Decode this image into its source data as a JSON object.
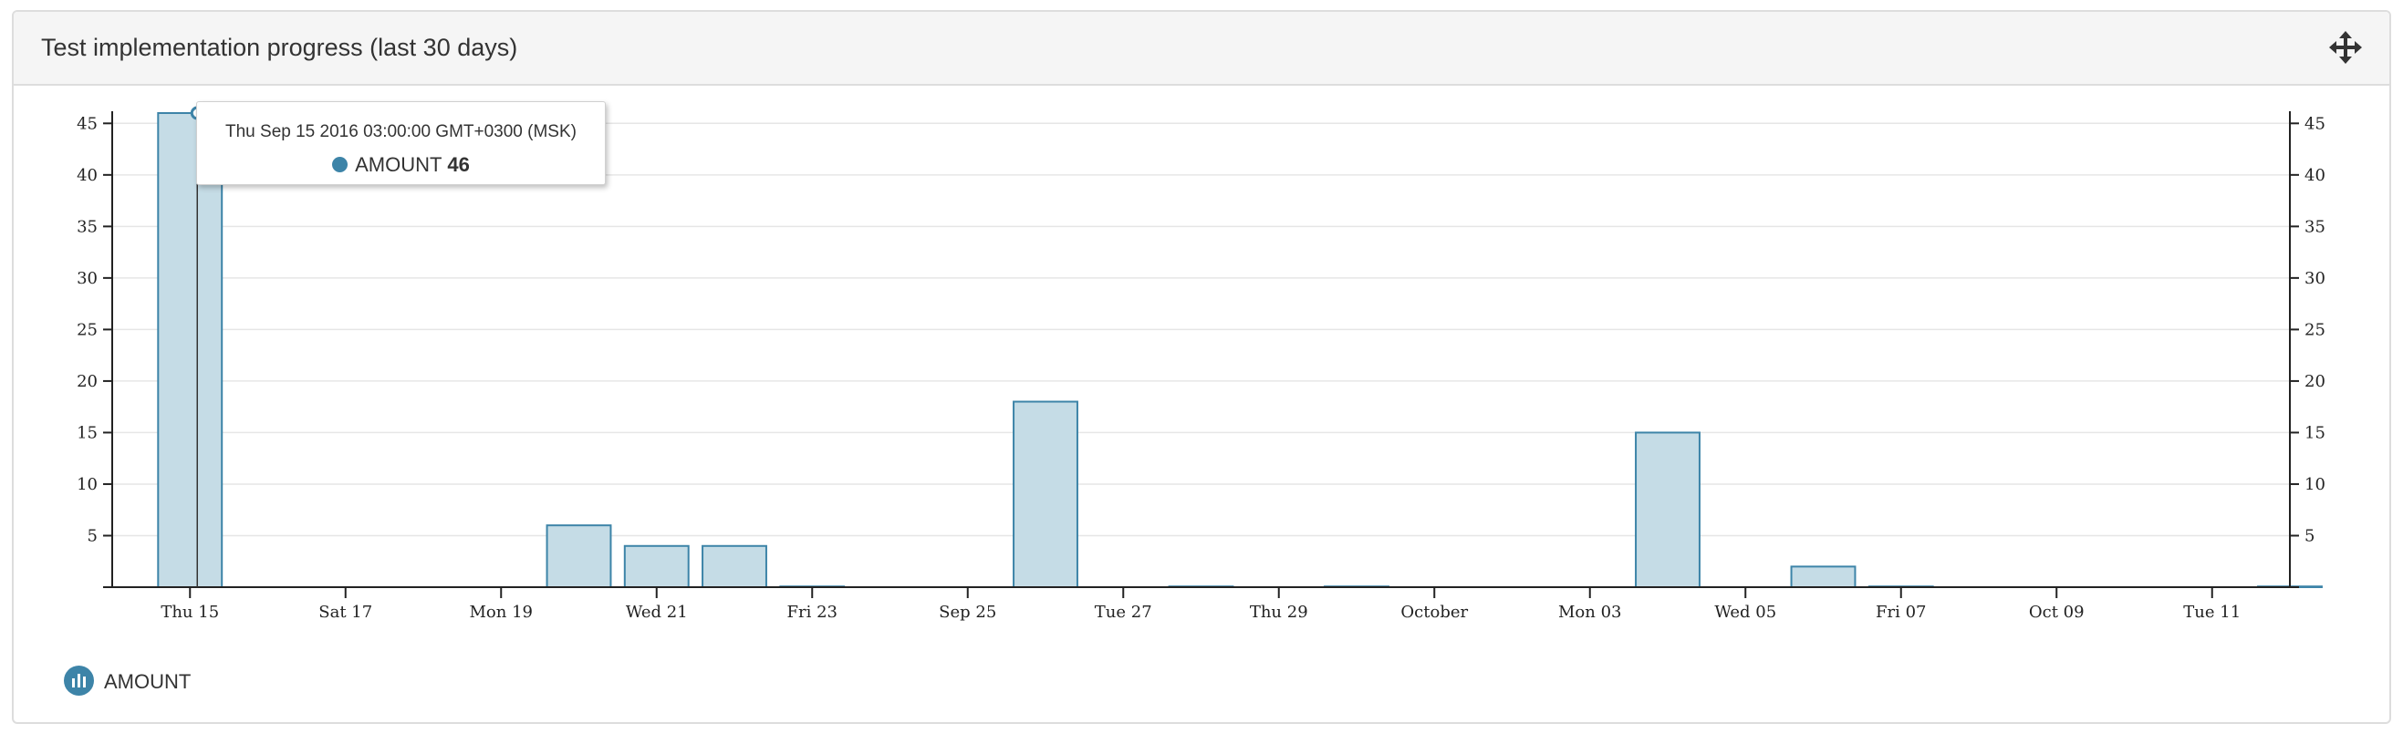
{
  "panel": {
    "title": "Test implementation progress (last 30 days)",
    "move_icon": "move-arrows-icon"
  },
  "colors": {
    "bar_fill": "#c5dce6",
    "bar_stroke": "#3d84a8",
    "axis": "#222222",
    "grid": "#e6e6e6",
    "legend_icon": "#3d84a8"
  },
  "chart_data": {
    "type": "bar",
    "title": "",
    "xlabel": "",
    "ylabel": "",
    "x_type": "date",
    "xlim": [
      "2016-09-14",
      "2016-10-12"
    ],
    "ylim": [
      0,
      46
    ],
    "y_ticks": [
      5,
      10,
      15,
      20,
      25,
      30,
      35,
      40,
      45
    ],
    "y_axis_right": true,
    "grid": true,
    "legend_position": "bottom-left",
    "x_ticks": [
      {
        "date": "2016-09-15",
        "label": "Thu 15"
      },
      {
        "date": "2016-09-17",
        "label": "Sat 17"
      },
      {
        "date": "2016-09-19",
        "label": "Mon 19"
      },
      {
        "date": "2016-09-21",
        "label": "Wed 21"
      },
      {
        "date": "2016-09-23",
        "label": "Fri 23"
      },
      {
        "date": "2016-09-25",
        "label": "Sep 25"
      },
      {
        "date": "2016-09-27",
        "label": "Tue 27"
      },
      {
        "date": "2016-09-29",
        "label": "Thu 29"
      },
      {
        "date": "2016-10-01",
        "label": "October"
      },
      {
        "date": "2016-10-03",
        "label": "Mon 03"
      },
      {
        "date": "2016-10-05",
        "label": "Wed 05"
      },
      {
        "date": "2016-10-07",
        "label": "Fri 07"
      },
      {
        "date": "2016-10-09",
        "label": "Oct 09"
      },
      {
        "date": "2016-10-11",
        "label": "Tue 11"
      }
    ],
    "series": [
      {
        "name": "AMOUNT",
        "points": [
          {
            "date": "2016-09-15",
            "value": 46
          },
          {
            "date": "2016-09-20",
            "value": 6
          },
          {
            "date": "2016-09-21",
            "value": 4
          },
          {
            "date": "2016-09-22",
            "value": 4
          },
          {
            "date": "2016-09-23",
            "value": 0
          },
          {
            "date": "2016-09-26",
            "value": 18
          },
          {
            "date": "2016-09-28",
            "value": 0
          },
          {
            "date": "2016-09-30",
            "value": 0
          },
          {
            "date": "2016-10-04",
            "value": 15
          },
          {
            "date": "2016-10-06",
            "value": 2
          },
          {
            "date": "2016-10-07",
            "value": 0
          },
          {
            "date": "2016-10-12",
            "value": 0
          }
        ]
      }
    ]
  },
  "tooltip": {
    "date": "Thu Sep 15 2016 03:00:00 GMT+0300 (MSK)",
    "series_name": "AMOUNT",
    "value": "46",
    "hovered_date": "2016-09-15"
  },
  "legend": {
    "label": "AMOUNT",
    "icon": "bar-chart-icon"
  }
}
